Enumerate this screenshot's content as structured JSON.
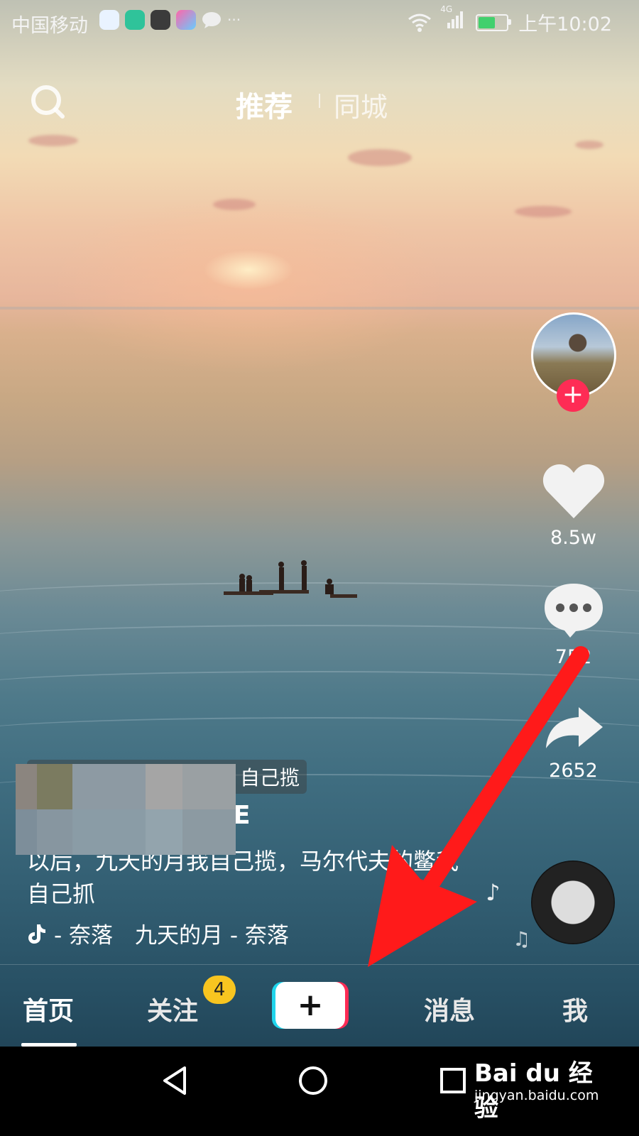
{
  "status_bar": {
    "carrier": "中国移动",
    "time": "上午10:02",
    "network": "4G",
    "app_icons": [
      "cmcc-app-icon",
      "meituan-app-icon",
      "camera-app-icon",
      "colorful-app-icon",
      "chat-app-icon"
    ],
    "more": "···"
  },
  "top_tabs": {
    "recommend": "推荐",
    "nearby": "同城"
  },
  "actions": {
    "likes": "8.5w",
    "comments": "752",
    "shares": "2652"
  },
  "video_info": {
    "tag_text": "自己揽",
    "username": "E",
    "description": "以后，九天的月我自己揽，马尔代夫的鳖我自己抓",
    "music": "- 奈落　九天的月 - 奈落"
  },
  "bottom_nav": {
    "home": "首页",
    "follow": "关注",
    "follow_badge": "4",
    "create": "+",
    "messages": "消息",
    "me": "我"
  },
  "watermark": {
    "brand": "Bai du 经验",
    "url": "jingyan.baidu.com"
  },
  "colors": {
    "accent_red": "#fe2c55",
    "accent_cyan": "#20d5ec",
    "badge_yellow": "#f8c520",
    "annotation_arrow": "#ff1a1a"
  }
}
